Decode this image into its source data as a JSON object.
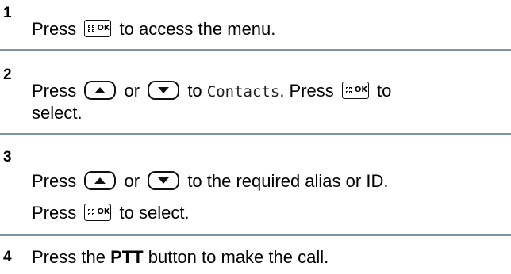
{
  "steps": [
    {
      "number": "1",
      "text_press": "Press",
      "text_after": "to access the menu."
    },
    {
      "number": "2",
      "text_press": "Press",
      "text_or": "or",
      "text_to": "to",
      "menu_item": "Contacts",
      "text_dot_press": ". Press",
      "text_to_end": "to",
      "text_select": "select."
    },
    {
      "number": "3",
      "text_press": "Press",
      "text_or": "or",
      "text_after": "to the required alias or ID.",
      "text_press2": "Press",
      "text_select": "to select."
    },
    {
      "number": "4",
      "text_before": "Press the",
      "button_name": "PTT",
      "text_after": "button to make the call."
    }
  ],
  "icons": {
    "menu_ok": "menu-ok-button-icon",
    "up": "up-arrow-button-icon",
    "down": "down-arrow-button-icon"
  },
  "button_ok_label": "OK",
  "colors": {
    "rule": "#7f93a3",
    "text": "#000000"
  }
}
